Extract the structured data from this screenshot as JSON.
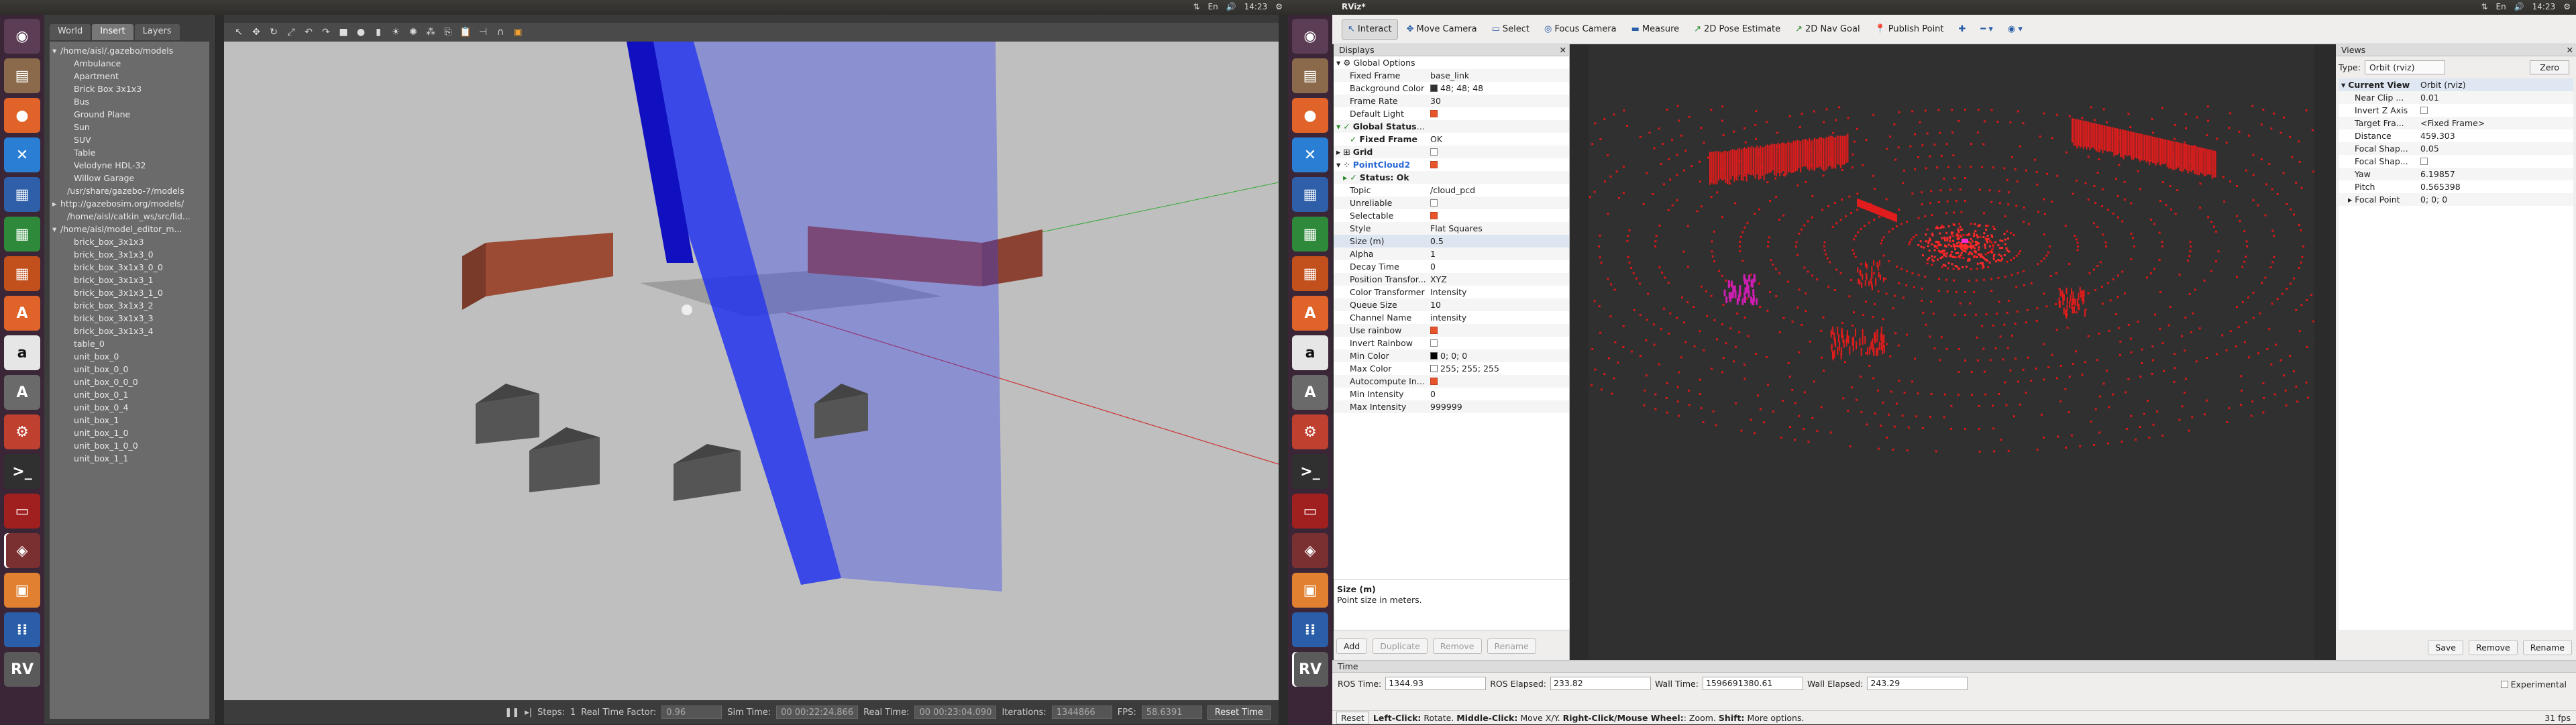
{
  "left_screen": {
    "topbar": {
      "time": "14:23",
      "kb": "En",
      "icons": [
        "network-icon",
        "keyboard-icon",
        "volume-icon",
        "gear-icon"
      ]
    },
    "gazebo": {
      "tabs": [
        "World",
        "Insert",
        "Layers"
      ],
      "tree": [
        {
          "label": "/home/aisl/.gazebo/models",
          "indent": 0,
          "caret": "▾"
        },
        {
          "label": "Ambulance",
          "indent": 2
        },
        {
          "label": "Apartment",
          "indent": 2
        },
        {
          "label": "Brick Box 3x1x3",
          "indent": 2
        },
        {
          "label": "Bus",
          "indent": 2
        },
        {
          "label": "Ground Plane",
          "indent": 2
        },
        {
          "label": "Sun",
          "indent": 2
        },
        {
          "label": "SUV",
          "indent": 2
        },
        {
          "label": "Table",
          "indent": 2
        },
        {
          "label": "Velodyne HDL-32",
          "indent": 2
        },
        {
          "label": "Willow Garage",
          "indent": 2
        },
        {
          "label": "/usr/share/gazebo-7/models",
          "indent": 1
        },
        {
          "label": "http://gazebosim.org/models/",
          "indent": 0,
          "caret": "▸"
        },
        {
          "label": "/home/aisl/catkin_ws/src/lid...",
          "indent": 1
        },
        {
          "label": "/home/aisl/model_editor_m...",
          "indent": 0,
          "caret": "▾"
        },
        {
          "label": "brick_box_3x1x3",
          "indent": 2
        },
        {
          "label": "brick_box_3x1x3_0",
          "indent": 2
        },
        {
          "label": "brick_box_3x1x3_0_0",
          "indent": 2
        },
        {
          "label": "brick_box_3x1x3_1",
          "indent": 2
        },
        {
          "label": "brick_box_3x1x3_1_0",
          "indent": 2
        },
        {
          "label": "brick_box_3x1x3_2",
          "indent": 2
        },
        {
          "label": "brick_box_3x1x3_3",
          "indent": 2
        },
        {
          "label": "brick_box_3x1x3_4",
          "indent": 2
        },
        {
          "label": "table_0",
          "indent": 2
        },
        {
          "label": "unit_box_0",
          "indent": 2
        },
        {
          "label": "unit_box_0_0",
          "indent": 2
        },
        {
          "label": "unit_box_0_0_0",
          "indent": 2
        },
        {
          "label": "unit_box_0_1",
          "indent": 2
        },
        {
          "label": "unit_box_0_4",
          "indent": 2
        },
        {
          "label": "unit_box_1",
          "indent": 2
        },
        {
          "label": "unit_box_1_0",
          "indent": 2
        },
        {
          "label": "unit_box_1_0_0",
          "indent": 2
        },
        {
          "label": "unit_box_1_1",
          "indent": 2
        }
      ],
      "bottom": {
        "steps_label": "Steps:",
        "steps_value": "1",
        "rtf_label": "Real Time Factor:",
        "rtf_value": "0.96",
        "sim_label": "Sim Time:",
        "sim_value": "00 00:22:24.866",
        "real_label": "Real Time:",
        "real_value": "00 00:23:04.090",
        "iter_label": "Iterations:",
        "iter_value": "1344866",
        "fps_label": "FPS:",
        "fps_value": "58.6391",
        "reset_label": "Reset Time"
      }
    }
  },
  "right_screen": {
    "topbar": {
      "title": "RViz*",
      "time": "14:23",
      "kb": "En"
    },
    "rviz": {
      "tools": [
        {
          "label": "Interact",
          "icon": "↖",
          "on": true
        },
        {
          "label": "Move Camera",
          "icon": "✥"
        },
        {
          "label": "Select",
          "icon": "▭"
        },
        {
          "label": "Focus Camera",
          "icon": "◎"
        },
        {
          "label": "Measure",
          "icon": "▬"
        },
        {
          "label": "2D Pose Estimate",
          "icon": "↗"
        },
        {
          "label": "2D Nav Goal",
          "icon": "↗"
        },
        {
          "label": "Publish Point",
          "icon": "📍"
        }
      ],
      "displays_title": "Displays",
      "displays": [
        {
          "k": "Global Options",
          "v": "",
          "lvl": 0,
          "caret": "▾",
          "ico": "⚙"
        },
        {
          "k": "Fixed Frame",
          "v": "base_link",
          "lvl": 2
        },
        {
          "k": "Background Color",
          "v": "48; 48; 48",
          "lvl": 2,
          "swatch": "#303030"
        },
        {
          "k": "Frame Rate",
          "v": "30",
          "lvl": 2
        },
        {
          "k": "Default Light",
          "v": "",
          "lvl": 2,
          "chk": true
        },
        {
          "k": "Global Status: Ok",
          "v": "",
          "lvl": 0,
          "caret": "▾",
          "ico": "✓",
          "bold": true
        },
        {
          "k": "Fixed Frame",
          "v": "OK",
          "lvl": 2,
          "ico": "✓",
          "bold": true
        },
        {
          "k": "Grid",
          "v": "",
          "lvl": 0,
          "caret": "▸",
          "ico": "⊞",
          "bold": true,
          "chk": false
        },
        {
          "k": "PointCloud2",
          "v": "",
          "lvl": 0,
          "caret": "▾",
          "ico": "⁘",
          "bold": true,
          "chk": true,
          "blue": true
        },
        {
          "k": "Status: Ok",
          "v": "",
          "lvl": 1,
          "caret": "▸",
          "ico": "✓",
          "bold": true
        },
        {
          "k": "Topic",
          "v": "/cloud_pcd",
          "lvl": 2
        },
        {
          "k": "Unreliable",
          "v": "",
          "lvl": 2,
          "chk": false
        },
        {
          "k": "Selectable",
          "v": "",
          "lvl": 2,
          "chk": true
        },
        {
          "k": "Style",
          "v": "Flat Squares",
          "lvl": 2
        },
        {
          "k": "Size (m)",
          "v": "0.5",
          "lvl": 2,
          "sel": true
        },
        {
          "k": "Alpha",
          "v": "1",
          "lvl": 2
        },
        {
          "k": "Decay Time",
          "v": "0",
          "lvl": 2
        },
        {
          "k": "Position Transfor...",
          "v": "XYZ",
          "lvl": 2
        },
        {
          "k": "Color Transformer",
          "v": "Intensity",
          "lvl": 2
        },
        {
          "k": "Queue Size",
          "v": "10",
          "lvl": 2
        },
        {
          "k": "Channel Name",
          "v": "intensity",
          "lvl": 2
        },
        {
          "k": "Use rainbow",
          "v": "",
          "lvl": 2,
          "chk": true
        },
        {
          "k": "Invert Rainbow",
          "v": "",
          "lvl": 2,
          "chk": false
        },
        {
          "k": "Min Color",
          "v": "0; 0; 0",
          "lvl": 2,
          "swatch": "#000000"
        },
        {
          "k": "Max Color",
          "v": "255; 255; 255",
          "lvl": 2,
          "swatch": "#ffffff"
        },
        {
          "k": "Autocompute Int...",
          "v": "",
          "lvl": 2,
          "chk": true
        },
        {
          "k": "Min Intensity",
          "v": "0",
          "lvl": 2
        },
        {
          "k": "Max Intensity",
          "v": "999999",
          "lvl": 2
        }
      ],
      "desc_title": "Size (m)",
      "desc_text": "Point size in meters.",
      "buttons": [
        {
          "label": "Add",
          "dis": false
        },
        {
          "label": "Duplicate",
          "dis": true
        },
        {
          "label": "Remove",
          "dis": true
        },
        {
          "label": "Rename",
          "dis": true
        }
      ],
      "views_title": "Views",
      "views_type_label": "Type:",
      "views_type_value": "Orbit (rviz)",
      "zero_label": "Zero",
      "views": [
        {
          "k": "Current View",
          "v": "Orbit (rviz)",
          "lvl": 0,
          "caret": "▾",
          "bold": true,
          "hl": true
        },
        {
          "k": "Near Clip ...",
          "v": "0.01",
          "lvl": 2
        },
        {
          "k": "Invert Z Axis",
          "v": "",
          "lvl": 2,
          "chk": false
        },
        {
          "k": "Target Fra...",
          "v": "<Fixed Frame>",
          "lvl": 2
        },
        {
          "k": "Distance",
          "v": "459.303",
          "lvl": 2
        },
        {
          "k": "Focal Shap...",
          "v": "0.05",
          "lvl": 2
        },
        {
          "k": "Focal Shap...",
          "v": "",
          "lvl": 2,
          "chk": false
        },
        {
          "k": "Yaw",
          "v": "6.19857",
          "lvl": 2
        },
        {
          "k": "Pitch",
          "v": "0.565398",
          "lvl": 2
        },
        {
          "k": "Focal Point",
          "v": "0; 0; 0",
          "lvl": 1,
          "caret": "▸"
        }
      ],
      "views_buttons": [
        "Save",
        "Remove",
        "Rename"
      ],
      "time_title": "Time",
      "time": [
        {
          "label": "ROS Time:",
          "value": "1344.93"
        },
        {
          "label": "ROS Elapsed:",
          "value": "233.82"
        },
        {
          "label": "Wall Time:",
          "value": "1596691380.61"
        },
        {
          "label": "Wall Elapsed:",
          "value": "243.29"
        }
      ],
      "experimental_label": "Experimental",
      "reset_label": "Reset",
      "hint_bold1": "Left-Click:",
      "hint1": " Rotate. ",
      "hint_bold2": "Middle-Click:",
      "hint2": " Move X/Y. ",
      "hint_bold3": "Right-Click/Mouse Wheel:",
      "hint3": ": Zoom. ",
      "hint_bold4": "Shift:",
      "hint4": " More options.",
      "fps": "31 fps"
    }
  },
  "launcher_icons": [
    {
      "name": "dash-icon",
      "color": "#5b3d55",
      "glyph": "◉"
    },
    {
      "name": "files-icon",
      "color": "#8a6a4a",
      "glyph": "▤"
    },
    {
      "name": "firefox-icon",
      "color": "#e0642a",
      "glyph": "●"
    },
    {
      "name": "vscode-icon",
      "color": "#2a7fd4",
      "glyph": "✕"
    },
    {
      "name": "writer-icon",
      "color": "#2e5fa8",
      "glyph": "▦"
    },
    {
      "name": "calc-icon",
      "color": "#2e8a3a",
      "glyph": "▦"
    },
    {
      "name": "impress-icon",
      "color": "#c2501d",
      "glyph": "▦"
    },
    {
      "name": "texteditor-icon",
      "color": "#e0642a",
      "glyph": "A"
    },
    {
      "name": "amazon-icon",
      "color": "#e6e6e6",
      "glyph": "a"
    },
    {
      "name": "software-icon",
      "color": "#6a6a6a",
      "glyph": "A"
    },
    {
      "name": "settings-icon",
      "color": "#c04030",
      "glyph": "⚙"
    },
    {
      "name": "terminal-icon",
      "color": "#303030",
      "glyph": ">_"
    },
    {
      "name": "screenshot-icon",
      "color": "#a02020",
      "glyph": "▭"
    },
    {
      "name": "gazebo-icon",
      "color": "#7a3030",
      "glyph": "◈"
    },
    {
      "name": "archive-icon",
      "color": "#e08030",
      "glyph": "▣"
    },
    {
      "name": "apps-icon",
      "color": "#2a5ea8",
      "glyph": "⁞⁞"
    },
    {
      "name": "rviz-icon",
      "color": "#5a5a5a",
      "glyph": "RV"
    }
  ]
}
